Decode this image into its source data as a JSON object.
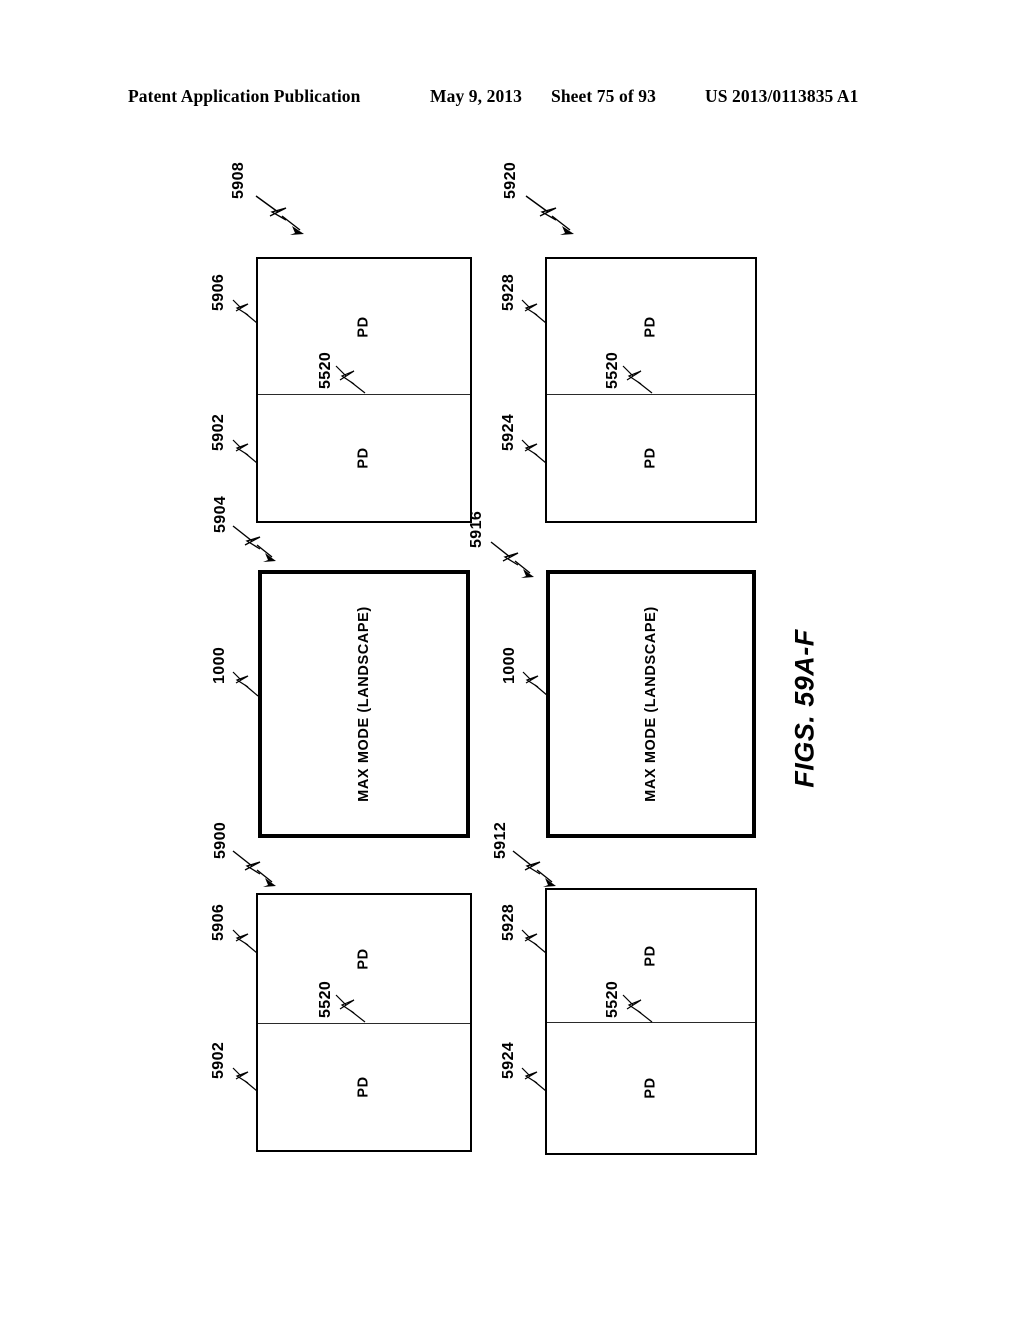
{
  "header": {
    "publication": "Patent Application Publication",
    "date": "May 9, 2013",
    "sheet": "Sheet 75 of 93",
    "patent_number": "US 2013/0113835 A1"
  },
  "figure": {
    "caption": "FIGS. 59A-F",
    "pane_label": "PD",
    "max_mode_label": "MAX MODE (LANDSCAPE)",
    "divider_ref": "5520"
  },
  "panels": [
    {
      "id": "top-left",
      "kind": "dual-pane",
      "arrow_ref": "5908",
      "upper_pane_ref": "5906",
      "lower_pane_ref": "5902",
      "divider_ref": "5520",
      "upper_pane_label": "PD",
      "lower_pane_label": "PD"
    },
    {
      "id": "top-right",
      "kind": "dual-pane",
      "arrow_ref": "5920",
      "upper_pane_ref": "5928",
      "lower_pane_ref": "5924",
      "divider_ref": "5520",
      "upper_pane_label": "PD",
      "lower_pane_label": "PD"
    },
    {
      "id": "middle-left",
      "kind": "max-mode",
      "arrow_ref": "5904",
      "device_ref": "1000",
      "center_label": "MAX MODE (LANDSCAPE)"
    },
    {
      "id": "middle-right",
      "kind": "max-mode",
      "arrow_ref": "5916",
      "device_ref": "1000",
      "center_label": "MAX MODE (LANDSCAPE)"
    },
    {
      "id": "bottom-left",
      "kind": "dual-pane",
      "arrow_ref": "5900",
      "upper_pane_ref": "5906",
      "lower_pane_ref": "5902",
      "divider_ref": "5520",
      "upper_pane_label": "PD",
      "lower_pane_label": "PD"
    },
    {
      "id": "bottom-right",
      "kind": "dual-pane",
      "arrow_ref": "5912",
      "upper_pane_ref": "5928",
      "lower_pane_ref": "5924",
      "divider_ref": "5520",
      "upper_pane_label": "PD",
      "lower_pane_label": "PD"
    }
  ],
  "colors": {
    "ink": "#000000",
    "paper": "#ffffff",
    "divider": "#2a2a2a"
  }
}
